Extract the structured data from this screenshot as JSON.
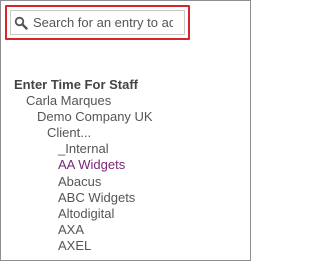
{
  "search": {
    "placeholder": "Search for an entry to add",
    "icon": "search-icon"
  },
  "highlight_color": "#d7262b",
  "tree": {
    "heading": "Enter Time For Staff",
    "staff": "Carla Marques",
    "company": "Demo Company UK",
    "client_group": "Client...",
    "clients": [
      "_Internal",
      "AA Widgets",
      "Abacus",
      "ABC Widgets",
      "Altodigital",
      "AXA",
      "AXEL"
    ],
    "selected_client": "AA Widgets",
    "selected_color": "#7a2678"
  }
}
